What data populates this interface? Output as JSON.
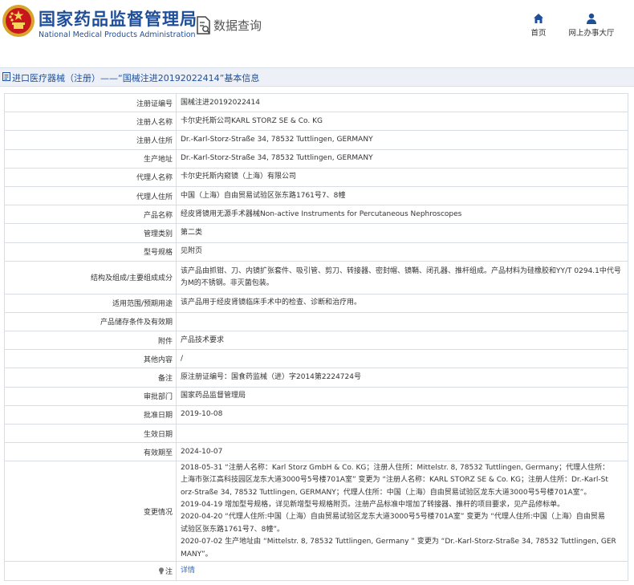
{
  "header": {
    "site_name": "国家药品监督管理局",
    "site_name_en": "National Medical Products Administration",
    "query_title": "数据查询",
    "nav": {
      "home": "首页",
      "online_office": "网上办事大厅"
    },
    "brand_color": "#1f4f9a"
  },
  "breadcrumb": "进口医疗器械（注册）——“国械注进20192022414”基本信息",
  "fields": {
    "reg_no": {
      "label": "注册证编号",
      "value": "国械注进20192022414"
    },
    "registrant": {
      "label": "注册人名称",
      "value": "卡尔史托斯公司KARL STORZ SE & Co. KG"
    },
    "registrant_addr": {
      "label": "注册人住所",
      "value": "Dr.-Karl-Storz-Straße 34, 78532 Tuttlingen, GERMANY"
    },
    "production_addr": {
      "label": "生产地址",
      "value": "Dr.-Karl-Storz-Straße 34, 78532 Tuttlingen, GERMANY"
    },
    "agent": {
      "label": "代理人名称",
      "value": "卡尔史托斯内窥镜（上海）有限公司"
    },
    "agent_addr": {
      "label": "代理人住所",
      "value": "中国（上海）自由贸易试验区张东路1761号7、8幢"
    },
    "product_name": {
      "label": "产品名称",
      "value": "经皮肾镜用无源手术器械Non-active Instruments for Percutaneous Nephroscopes"
    },
    "category": {
      "label": "管理类别",
      "value": "第二类"
    },
    "model": {
      "label": "型号规格",
      "value": "见附页"
    },
    "structure": {
      "label": "结构及组成/主要组成成分",
      "value": "该产品由抓钳、刀、内镜扩张套件、吸引管、剪刀、转接器、密封帽、镜鞘、闭孔器、推杆组成。产品材料为硅橡胶和YY/T 0294.1中代号为M的不锈钢。非灭菌包装。"
    },
    "intended_use": {
      "label": "适用范围/预期用途",
      "value": "该产品用于经皮肾镜临床手术中的检查、诊断和治疗用。"
    },
    "storage": {
      "label": "产品储存条件及有效期",
      "value": ""
    },
    "attachment": {
      "label": "附件",
      "value": "产品技术要求"
    },
    "other": {
      "label": "其他内容",
      "value": "/"
    },
    "remarks": {
      "label": "备注",
      "value": "原注册证编号：国食药监械（进）字2014第2224724号"
    },
    "approval_dept": {
      "label": "审批部门",
      "value": "国家药品监督管理局"
    },
    "approval_date": {
      "label": "批准日期",
      "value": "2019-10-08"
    },
    "effective_date": {
      "label": "生效日期",
      "value": ""
    },
    "expiry_date": {
      "label": "有效期至",
      "value": "2024-10-07"
    },
    "changes": {
      "label": "变更情况",
      "lines": [
        "2018-05-31 “注册人名称：Karl Storz GmbH & Co. KG；注册人住所：Mittelstr. 8, 78532 Tuttlingen, Germany；代理人住所：",
        "上海市张江高科技园区龙东大道3000号5号楼701A室” 变更为 “注册人名称：KARL STORZ SE & Co. KG；注册人住所：Dr.-Karl-St",
        "orz-Straße 34, 78532 Tuttlingen, GERMANY；代理人住所：中国（上海）自由贸易试验区龙东大道3000号5号楼701A室”。",
        "2019-04-19 增加型号规格，详见新增型号规格附页。注册产品标准中增加了转接器、推杆的项目要求，见产品修标单。",
        "2020-04-20 “代理人住所:中国（上海）自由贸易试验区龙东大道3000号5号楼701A室” 变更为 “代理人住所:中国（上海）自由贸易",
        "试验区张东路1761号7、8幢”。",
        "2020-07-02 生产地址由 “Mittelstr. 8, 78532 Tuttlingen, Germany ” 变更为 “Dr.-Karl-Storz-Straße 34, 78532 Tuttlingen, GER",
        "MANY”。"
      ]
    },
    "note": {
      "label": "注",
      "link": "详情"
    }
  }
}
